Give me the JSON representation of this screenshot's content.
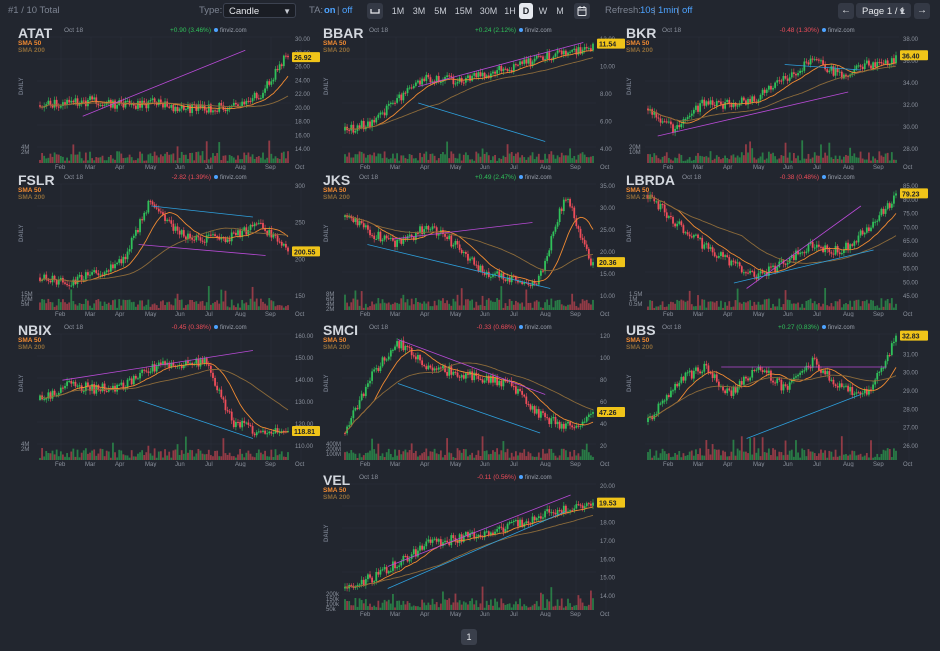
{
  "toolbar": {
    "count": "#1 / 10 Total",
    "type_label": "Type:",
    "type_value": "Candle",
    "ta_label": "TA:",
    "ta_on": "on",
    "ta_sep": "|",
    "ta_off": "off",
    "timeframes": [
      "1M",
      "3M",
      "5M",
      "15M",
      "30M",
      "1H",
      "D",
      "W",
      "M"
    ],
    "active_timeframe": "D",
    "refresh_label": "Refresh:",
    "refresh_10s": "10s",
    "refresh_1min": "1min",
    "refresh_off": "off",
    "page_value": "Page 1 / 1",
    "prev_icon": "←",
    "next_icon": "→"
  },
  "common": {
    "date": "Oct 18",
    "brand": "finviz.com",
    "sma50": "SMA 50",
    "sma200": "SMA 200",
    "daily": "DAILY",
    "months": [
      "Feb",
      "Mar",
      "Apr",
      "May",
      "Jun",
      "Jul",
      "Aug",
      "Sep",
      "Oct"
    ]
  },
  "colors": {
    "background": "#22262f",
    "up": "#30c15a",
    "down": "#ef4d5a",
    "sma50": "#f08a32",
    "sma200": "#8b6a3a",
    "trend_purple": "#b84ad6",
    "trend_blue": "#2e9fdc",
    "price_label": "#f0c419",
    "link": "#4da3ff"
  },
  "charts": [
    {
      "ticker": "ATAT",
      "change": "+0.90 (3.46%)",
      "dir": "up",
      "price": "26.92",
      "yticks": [
        "30.00",
        "28.00",
        "26.00",
        "24.00",
        "22.00",
        "20.00",
        "18.00",
        "16.00",
        "14.00"
      ],
      "vticks": [
        "4M",
        "2M"
      ]
    },
    {
      "ticker": "BBAR",
      "change": "+0.24 (2.12%)",
      "dir": "up",
      "price": "11.54",
      "yticks": [
        "12.00",
        "10.00",
        "8.00",
        "6.00",
        "4.00"
      ],
      "vticks": []
    },
    {
      "ticker": "BKR",
      "change": "-0.48 (1.30%)",
      "dir": "down",
      "price": "36.40",
      "yticks": [
        "38.00",
        "36.00",
        "34.00",
        "32.00",
        "30.00",
        "28.00"
      ],
      "vticks": [
        "20M",
        "10M"
      ]
    },
    {
      "ticker": "FSLR",
      "change": "-2.82 (1.39%)",
      "dir": "down",
      "price": "200.55",
      "yticks": [
        "300",
        "250",
        "200",
        "150"
      ],
      "vticks": [
        "15M",
        "10M",
        "5M"
      ]
    },
    {
      "ticker": "JKS",
      "change": "+0.49 (2.47%)",
      "dir": "up",
      "price": "20.36",
      "yticks": [
        "35.00",
        "30.00",
        "25.00",
        "20.00",
        "15.00",
        "10.00"
      ],
      "vticks": [
        "8M",
        "6M",
        "4M",
        "2M"
      ]
    },
    {
      "ticker": "LBRDA",
      "change": "-0.38 (0.48%)",
      "dir": "down",
      "price": "79.23",
      "yticks": [
        "85.00",
        "80.00",
        "75.00",
        "70.00",
        "65.00",
        "60.00",
        "55.00",
        "50.00",
        "45.00"
      ],
      "vticks": [
        "1.5M",
        "1M",
        "0.5M"
      ]
    },
    {
      "ticker": "NBIX",
      "change": "-0.45 (0.38%)",
      "dir": "down",
      "price": "118.81",
      "yticks": [
        "160.00",
        "150.00",
        "140.00",
        "130.00",
        "120.00",
        "110.00"
      ],
      "vticks": [
        "4M",
        "2M"
      ]
    },
    {
      "ticker": "SMCI",
      "change": "-0.33 (0.68%)",
      "dir": "down",
      "price": "47.26",
      "yticks": [
        "120",
        "100",
        "80",
        "60",
        "40",
        "20"
      ],
      "vticks": [
        "400M",
        "200M",
        "100M"
      ]
    },
    {
      "ticker": "UBS",
      "change": "+0.27 (0.83%)",
      "dir": "up",
      "price": "32.83",
      "yticks": [
        "32.00",
        "31.00",
        "30.00",
        "29.00",
        "28.00",
        "27.00",
        "26.00"
      ],
      "vticks": []
    },
    {
      "ticker": "VEL",
      "change": "-0.11 (0.56%)",
      "dir": "down",
      "price": "19.53",
      "yticks": [
        "20.00",
        "19.00",
        "18.00",
        "17.00",
        "16.00",
        "15.00",
        "14.00"
      ],
      "vticks": [
        "200k",
        "150k",
        "100k",
        "50k"
      ]
    }
  ],
  "pager": {
    "page": "1"
  }
}
